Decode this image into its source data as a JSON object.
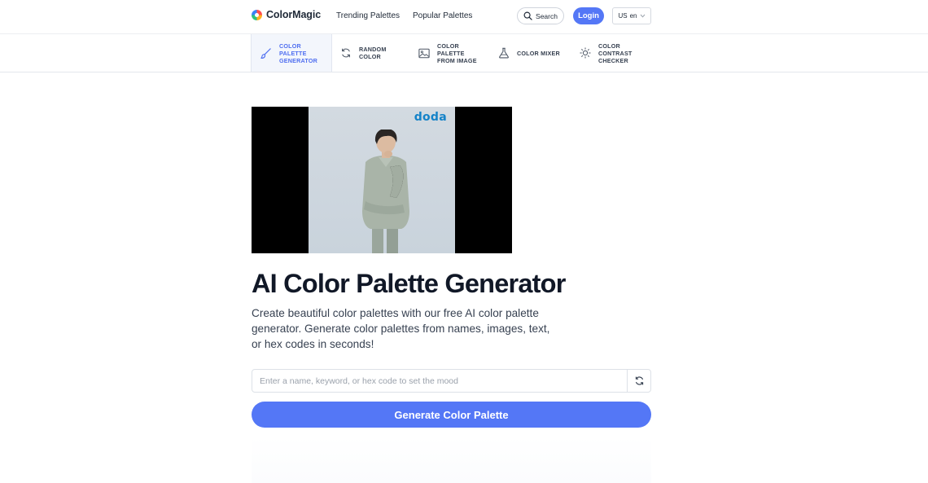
{
  "brand": {
    "name": "ColorMagic"
  },
  "header": {
    "nav": [
      "Trending Palettes",
      "Popular Palettes"
    ],
    "search_label": "Search",
    "login_label": "Login",
    "language": {
      "region": "US",
      "lang": "en"
    }
  },
  "tools": [
    {
      "label": "COLOR PALETTE GENERATOR",
      "icon": "brush-icon",
      "active": true
    },
    {
      "label": "RANDOM COLOR",
      "icon": "refresh-icon",
      "active": false
    },
    {
      "label": "COLOR PALETTE FROM IMAGE",
      "icon": "image-icon",
      "active": false
    },
    {
      "label": "COLOR MIXER",
      "icon": "flask-icon",
      "active": false
    },
    {
      "label": "COLOR CONTRAST CHECKER",
      "icon": "sun-icon",
      "active": false
    }
  ],
  "media": {
    "brand_watermark": "doda"
  },
  "hero": {
    "title": "AI Color Palette Generator",
    "description": "Create beautiful color palettes with our free AI color palette generator. Generate color palettes from names, images, text, or hex codes in seconds!"
  },
  "form": {
    "input_value": "",
    "input_placeholder": "Enter a name, keyword, or hex code to set the mood",
    "generate_label": "Generate Color Palette"
  },
  "colors": {
    "accent": "#5477f6",
    "active_tool_text": "#4f6ef0",
    "heading": "#111827"
  }
}
